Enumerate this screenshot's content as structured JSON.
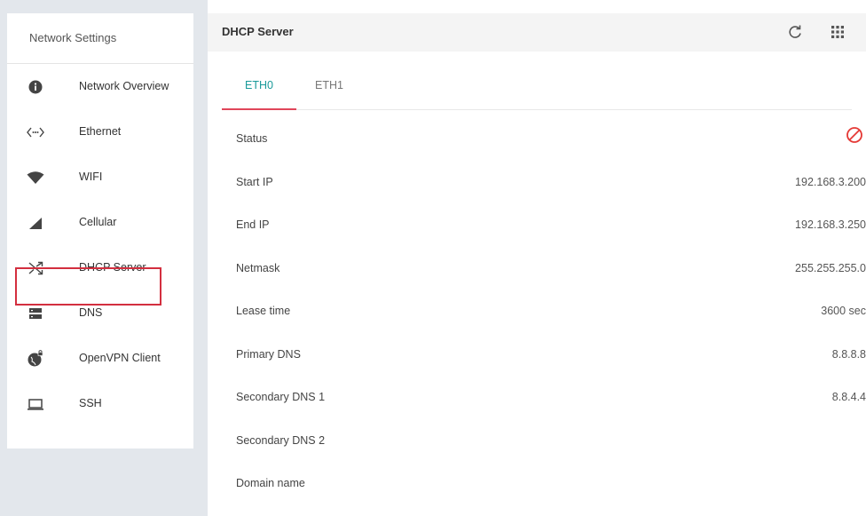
{
  "sidebar": {
    "title": "Network Settings",
    "items": [
      {
        "label": "Network Overview",
        "icon": "info-icon"
      },
      {
        "label": "Ethernet",
        "icon": "ethernet-icon"
      },
      {
        "label": "WIFI",
        "icon": "wifi-icon"
      },
      {
        "label": "Cellular",
        "icon": "cellular-signal-icon"
      },
      {
        "label": "DHCP Server",
        "icon": "shuffle-icon",
        "highlighted": true
      },
      {
        "label": "DNS",
        "icon": "server-icon"
      },
      {
        "label": "OpenVPN Client",
        "icon": "globe-lock-icon"
      },
      {
        "label": "SSH",
        "icon": "laptop-icon"
      }
    ]
  },
  "header": {
    "title": "DHCP Server",
    "refresh_icon": "refresh-icon",
    "apps_icon": "apps-grid-icon"
  },
  "tabs": [
    {
      "label": "ETH0",
      "active": true
    },
    {
      "label": "ETH1",
      "active": false
    }
  ],
  "details": [
    {
      "key": "Status",
      "value": "",
      "icon": "disabled-icon"
    },
    {
      "key": "Start IP",
      "value": "192.168.3.200"
    },
    {
      "key": "End IP",
      "value": "192.168.3.250"
    },
    {
      "key": "Netmask",
      "value": "255.255.255.0"
    },
    {
      "key": "Lease time",
      "value": "3600 sec"
    },
    {
      "key": "Primary DNS",
      "value": "8.8.8.8"
    },
    {
      "key": "Secondary DNS 1",
      "value": "8.8.4.4"
    },
    {
      "key": "Secondary DNS 2",
      "value": ""
    },
    {
      "key": "Domain name",
      "value": ""
    }
  ],
  "colors": {
    "accent_tab_text": "#1a9a9a",
    "tab_underline": "#e0455a",
    "status_disabled": "#e53935",
    "highlight_border": "#d32f3f",
    "sidebar_background": "#e3e7ec"
  }
}
